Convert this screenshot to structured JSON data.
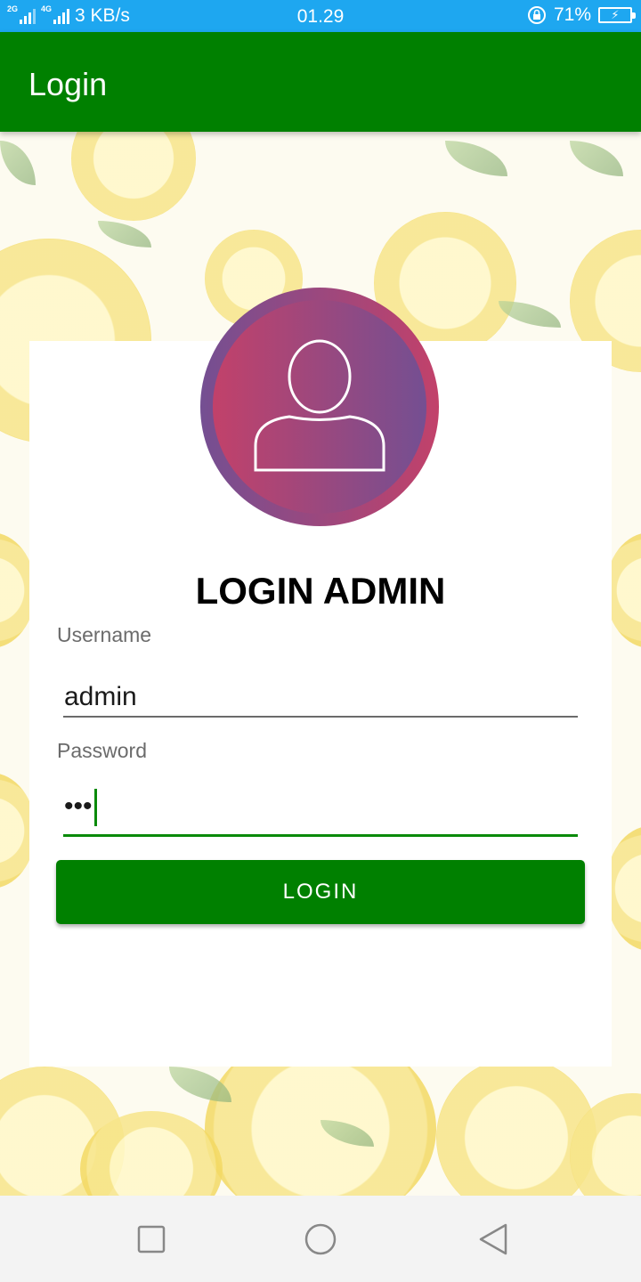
{
  "status_bar": {
    "network1": "2G",
    "network2": "4G",
    "speed": "3 KB/s",
    "time": "01.29",
    "battery_percent": "71%"
  },
  "app_bar": {
    "title": "Login"
  },
  "form": {
    "heading": "LOGIN ADMIN",
    "username_label": "Username",
    "username_value": "admin",
    "password_label": "Password",
    "password_value": "•••",
    "login_button": "LOGIN"
  },
  "nav": {
    "recent_icon": "square-icon",
    "home_icon": "circle-icon",
    "back_icon": "triangle-back-icon"
  },
  "colors": {
    "status_bar": "#1ea7f0",
    "primary": "#008000",
    "avatar_gradient": [
      "#744f92",
      "#c2416a"
    ]
  }
}
